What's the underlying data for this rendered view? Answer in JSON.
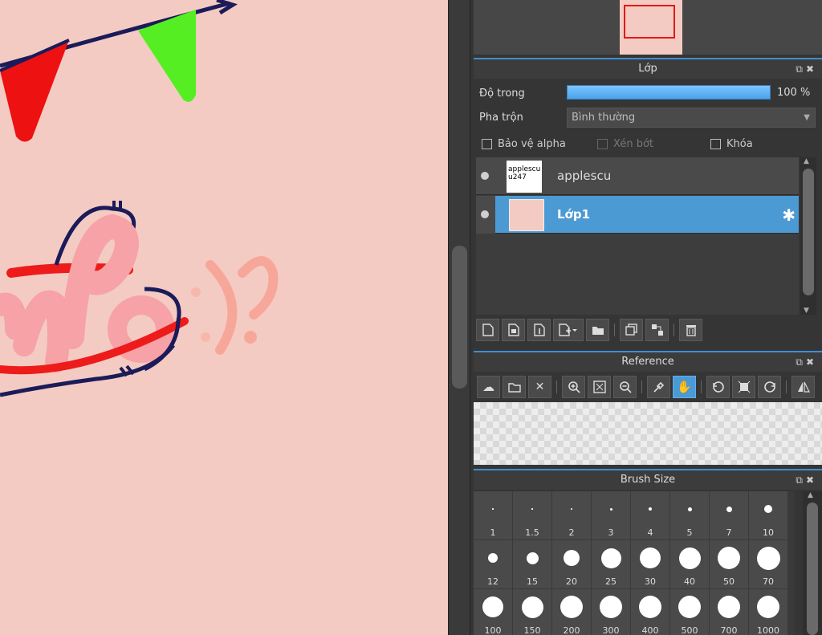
{
  "navigator": {
    "thumbnail_label": "navigator-preview"
  },
  "layer_panel": {
    "title": "Lớp",
    "opacity_label": "Độ trong",
    "opacity_value": "100 %",
    "opacity_fraction": 1.0,
    "blend_label": "Pha trộn",
    "blend_value": "Bình thường",
    "protect_alpha": "Bảo vệ alpha",
    "clipping": "Xén bớt",
    "lock": "Khóa",
    "layers": [
      {
        "name": "applescu",
        "thumb_text": "applescu\nu247"
      },
      {
        "name": "Lớp1"
      }
    ]
  },
  "reference_panel": {
    "title": "Reference"
  },
  "brush_panel": {
    "title": "Brush Size",
    "sizes": [
      "1",
      "1.5",
      "2",
      "3",
      "4",
      "5",
      "7",
      "10",
      "12",
      "15",
      "20",
      "25",
      "30",
      "40",
      "50",
      "70",
      "100",
      "150",
      "200",
      "300",
      "400",
      "500",
      "700",
      "1000"
    ]
  },
  "colors": {
    "canvas_bg": "#f4cbc2",
    "accent": "#4c9ad3",
    "panel_bg": "#353535"
  }
}
